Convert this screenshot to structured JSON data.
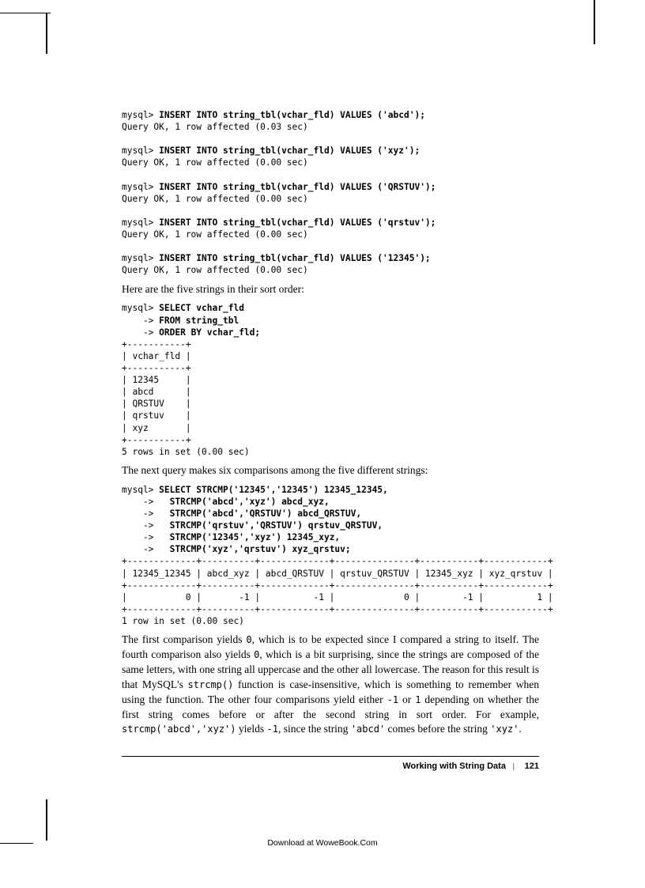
{
  "code1_a": "mysql> ",
  "code1_b": "INSERT INTO string_tbl(vchar_fld) VALUES ('abcd');",
  "code1_c": "Query OK, 1 row affected (0.03 sec)",
  "code2_a": "mysql> ",
  "code2_b": "INSERT INTO string_tbl(vchar_fld) VALUES ('xyz');",
  "code2_c": "Query OK, 1 row affected (0.00 sec)",
  "code3_a": "mysql> ",
  "code3_b": "INSERT INTO string_tbl(vchar_fld) VALUES ('QRSTUV');",
  "code3_c": "Query OK, 1 row affected (0.00 sec)",
  "code4_a": "mysql> ",
  "code4_b": "INSERT INTO string_tbl(vchar_fld) VALUES ('qrstuv');",
  "code4_c": "Query OK, 1 row affected (0.00 sec)",
  "code5_a": "mysql> ",
  "code5_b": "INSERT INTO string_tbl(vchar_fld) VALUES ('12345');",
  "code5_c": "Query OK, 1 row affected (0.00 sec)",
  "para1": "Here are the five strings in their sort order:",
  "sel_a": "mysql> ",
  "sel_b": "SELECT vchar_fld",
  "sel_c": "    -> ",
  "sel_d": "FROM string_tbl",
  "sel_e": "    -> ",
  "sel_f": "ORDER BY vchar_fld;",
  "sel_table": "+-----------+\n| vchar_fld |\n+-----------+\n| 12345     |\n| abcd      |\n| QRSTUV    |\n| qrstuv    |\n| xyz       |\n+-----------+\n5 rows in set (0.00 sec)",
  "para2": "The next query makes six comparisons among the five different strings:",
  "cmp_a": "mysql> ",
  "cmp_b": "SELECT STRCMP('12345','12345') 12345_12345,",
  "cmp_c": "    ->   ",
  "cmp_d": "STRCMP('abcd','xyz') abcd_xyz,",
  "cmp_e": "    ->   ",
  "cmp_f": "STRCMP('abcd','QRSTUV') abcd_QRSTUV,",
  "cmp_g": "    ->   ",
  "cmp_h": "STRCMP('qrstuv','QRSTUV') qrstuv_QRSTUV,",
  "cmp_i": "    ->   ",
  "cmp_j": "STRCMP('12345','xyz') 12345_xyz,",
  "cmp_k": "    ->   ",
  "cmp_l": "STRCMP('xyz','qrstuv') xyz_qrstuv;",
  "cmp_table": "+-------------+----------+-------------+---------------+-----------+------------+\n| 12345_12345 | abcd_xyz | abcd_QRSTUV | qrstuv_QRSTUV | 12345_xyz | xyz_qrstuv |\n+-------------+----------+-------------+---------------+-----------+------------+\n|           0 |       -1 |          -1 |             0 |        -1 |          1 |\n+-------------+----------+-------------+---------------+-----------+------------+\n1 row in set (0.00 sec)",
  "para3_1": "The first comparison yields ",
  "para3_2": "0",
  "para3_3": ", which is to be expected since I compared a string to itself. The fourth comparison also yields ",
  "para3_4": "0",
  "para3_5": ", which is a bit surprising, since the strings are composed of the same letters, with one string all uppercase and the other all lowercase. The reason for this result is that MySQL's ",
  "para3_6": "strcmp()",
  "para3_7": " function is case-insensitive, which is something to remember when using the function. The other four comparisons yield either ",
  "para3_8": "-1",
  "para3_9": " or ",
  "para3_10": "1",
  "para3_11": " depending on whether the first string comes before or after the second string in sort order. For example, ",
  "para3_12": "strcmp('abcd','xyz')",
  "para3_13": " yields ",
  "para3_14": "-1",
  "para3_15": ", since the string ",
  "para3_16": "'abcd'",
  "para3_17": " comes before the string ",
  "para3_18": "'xyz'",
  "para3_19": ".",
  "footer_title": "Working with String Data",
  "footer_sep": "|",
  "footer_page": "121",
  "download": "Download at WoweBook.Com"
}
